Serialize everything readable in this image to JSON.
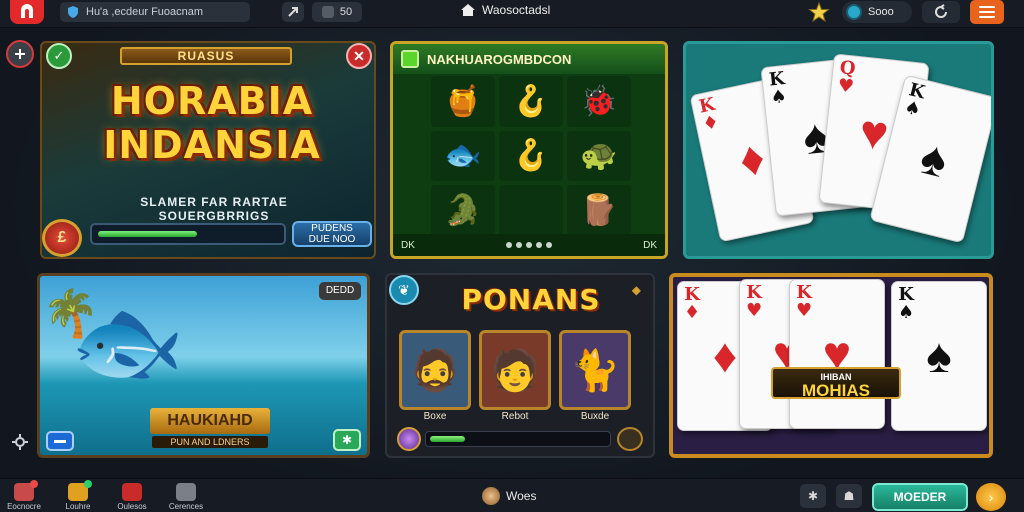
{
  "topbar": {
    "search_placeholder": "Hu'a ,ecdeur Fuoacnam",
    "btn_play_label": "",
    "btn_counter": "50",
    "center_title": "Waosoctadsl",
    "coins": "Sooo",
    "icons": {
      "logo": "app-logo-icon",
      "shield": "shield-icon",
      "arrow": "arrow-icon",
      "star": "star-icon",
      "refresh": "refresh-icon",
      "menu": "menu-icon"
    }
  },
  "cards": {
    "card1": {
      "banner": "RUASUS",
      "title_line1": "HORABIA",
      "title_line2": "INDANSIA",
      "subtitle": "SLAMER FAR RARTAE SOUERGBRRIGS",
      "chip": "£",
      "progress": 0.55,
      "button_line1": "PUDENS",
      "button_line2": "DUE NOO"
    },
    "card2": {
      "title": "NAKHUAROGMBDCON",
      "left_tag": "DK",
      "right_tag": "DK",
      "reels": [
        "🍯",
        "🪝",
        "🐞",
        "🐟",
        "🪝",
        "🐢",
        "🐊",
        "",
        "🪵"
      ]
    },
    "card3": {
      "cards": [
        {
          "rank": "K",
          "suit": "♦",
          "color": "red"
        },
        {
          "rank": "K",
          "suit": "♠",
          "color": "blk"
        },
        {
          "rank": "Q",
          "suit": "♥",
          "color": "red"
        },
        {
          "rank": "K",
          "suit": "♠",
          "color": "blk"
        }
      ]
    },
    "card4": {
      "badge": "DEDD",
      "title": "HAUKIAHD",
      "subtitle": "PUN AND LDNERS"
    },
    "card5": {
      "title": "PONANS",
      "heroes": [
        {
          "label": "Boxe",
          "emoji": "🧔"
        },
        {
          "label": "Rebot",
          "emoji": "🧑"
        },
        {
          "label": "Buxde",
          "emoji": "🐈"
        }
      ],
      "progress": 0.2
    },
    "card6": {
      "title_small": "IHIBAN",
      "title": "MOHIAS",
      "cards": [
        {
          "rank": "K",
          "suit": "♦",
          "color": "red"
        },
        {
          "rank": "K",
          "suit": "♥",
          "color": "red"
        },
        {
          "rank": "K",
          "suit": "♥",
          "color": "red"
        },
        {
          "rank": "K",
          "suit": "♠",
          "color": "blk"
        }
      ]
    }
  },
  "bottombar": {
    "nav": [
      {
        "label": "Eocnocre",
        "color": "#c94a4a",
        "dot": "#e84a4a"
      },
      {
        "label": "Louhre",
        "color": "#e0a020",
        "dot": "#2ad06a"
      },
      {
        "label": "Oulesos",
        "color": "#c92a2a",
        "dot": ""
      },
      {
        "label": "Cerences",
        "color": "#7a7f88",
        "dot": ""
      }
    ],
    "user_name": "Woes",
    "cta_label": "MOEDER",
    "icons": {
      "settings": "gear-icon",
      "profile": "profile-icon",
      "next": "chevron-right-icon"
    }
  },
  "colors": {
    "accent": "#e8631c",
    "brand_red": "#e22a2a",
    "cta": "#2ab89a",
    "gold": "#d6a030"
  }
}
